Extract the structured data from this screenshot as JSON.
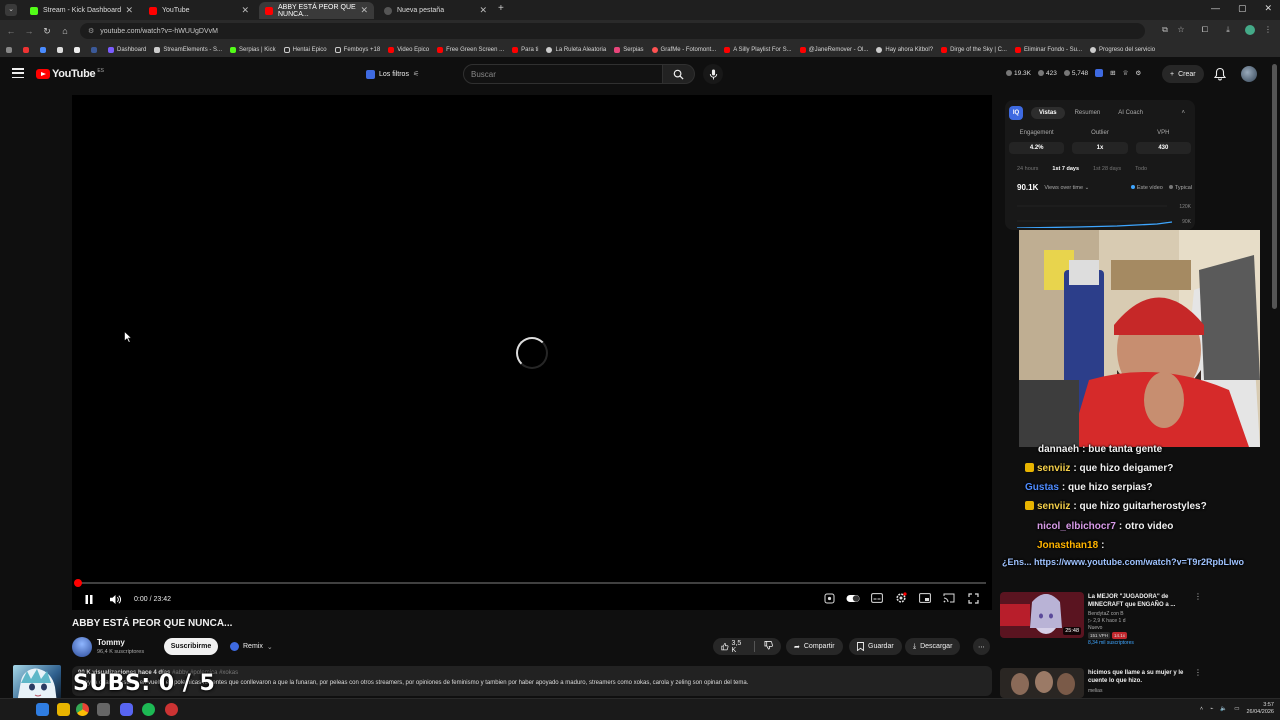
{
  "browser": {
    "tabs": [
      {
        "title": "Stream - Kick Dashboard",
        "color": "#53fc18",
        "active": false
      },
      {
        "title": "YouTube",
        "color": "#ff0000",
        "active": false
      },
      {
        "title": "ABBY ESTÁ PEOR QUE NUNCA...",
        "color": "#ff0000",
        "active": true
      },
      {
        "title": "Nueva pestaña",
        "color": "#cccccc",
        "active": false
      }
    ],
    "new_tab": "+",
    "url": "youtube.com/watch?v=-hWUUgDVvM",
    "bookmarks": [
      {
        "label": "Dashboard",
        "color": "#7b5cff"
      },
      {
        "label": "StreamElements - S...",
        "color": "#cccccc"
      },
      {
        "label": "Serpias | Kick",
        "color": "#53fc18"
      },
      {
        "label": "Hentai Epico",
        "color": "#cccccc"
      },
      {
        "label": "Femboys +18",
        "color": "#cccccc"
      },
      {
        "label": "Video Epico",
        "color": "#ff0000"
      },
      {
        "label": "Free Green Screen ...",
        "color": "#ff0000"
      },
      {
        "label": "Para ti",
        "color": "#ff0000"
      },
      {
        "label": "La Ruleta Aleatoria",
        "color": "#cccccc"
      },
      {
        "label": "Serpias",
        "color": "#e8457a"
      },
      {
        "label": "GrafMe - Fotomont...",
        "color": "#ff5252"
      },
      {
        "label": "A Silly Playlist For S...",
        "color": "#ff0000"
      },
      {
        "label": "@JaneRemover - Ol...",
        "color": "#ff0000"
      },
      {
        "label": "Hay ahora Kitbol?",
        "color": "#cccccc"
      },
      {
        "label": "Dirge of the Sky | C...",
        "color": "#ff0000"
      },
      {
        "label": "Eliminar Fondo - Su...",
        "color": "#ff0000"
      },
      {
        "label": "Progreso del servicio",
        "color": "#cccccc"
      }
    ]
  },
  "masthead": {
    "logo_text": "YouTube",
    "logo_country": "ES",
    "filters_label": "Los filtros",
    "search_placeholder": "Buscar",
    "stats": [
      "19.3K",
      "423",
      "5,748"
    ],
    "create_label": "Crear"
  },
  "player": {
    "state": "loading",
    "progress": 0.0,
    "time_current": "0:00",
    "time_total": "23:42",
    "time_display": "0:00 / 23:42"
  },
  "video": {
    "title": "ABBY ESTÁ PEOR QUE NUNCA...",
    "channel_name": "Tommy",
    "channel_subs": "96,4 K suscriptores",
    "subscribe_label": "Suscribirme",
    "remix_label": "Remix",
    "likes": "3,5 K",
    "share_label": "Compartir",
    "save_label": "Guardar",
    "download_label": "Descargar",
    "desc_meta": "90 K visualizaciones  hace 4 días",
    "desc_tags": "#abby #polemica #xokas",
    "desc_text": "abby la cual ha estado en vuelta en polemicas resientes que conllevaron a que la funaran, por peleas con otros streamers, por opiniones de feminismo y tambien por haber apoyado a maduro, streamers como xokas, carola y zeling son opinan del tema."
  },
  "overlay": {
    "subs_counter": "SUBS: 0 / 5"
  },
  "side_panel": {
    "logo": "IQ",
    "tabs": [
      "Vistas",
      "Resumen",
      "AI Coach"
    ],
    "active_tab": "Vistas",
    "metrics": [
      {
        "label": "Engagement",
        "value": "4.2%"
      },
      {
        "label": "Outlier",
        "value": "1x"
      },
      {
        "label": "VPH",
        "value": "430"
      }
    ],
    "ranges": [
      "24 hours",
      "1st 7 days",
      "1st 28 days",
      "Todo"
    ],
    "active_range": "1st 7 days",
    "views_total": "90.1K",
    "views_dropdown": "Views over time",
    "legend_this": "Este vídeo",
    "legend_typical": "Typical",
    "chart_ticks": [
      "120K",
      "90K"
    ]
  },
  "chat": [
    {
      "user": "dannaeh",
      "message": "bue tanta gente",
      "color": "#ffffff",
      "badge": false
    },
    {
      "user": "senviiz",
      "message": "que hizo deigamer?",
      "color": "#ffffff",
      "badge": true
    },
    {
      "user": "Gustas",
      "message": "que hizo serpias?",
      "color": "#4f8cff",
      "badge": false
    },
    {
      "user": "senviiz",
      "message": "que hizo guitarherostyles?",
      "color": "#ffffff",
      "badge": true
    },
    {
      "user": "nicol_elbichocr7",
      "message": "otro video",
      "color": "#ffffff",
      "badge": false
    },
    {
      "user": "Jonasthan18",
      "message": "",
      "color": "#ffb400",
      "badge": false
    },
    {
      "user": "",
      "message": "¿Ens... https://www.youtube.com/watch?v=T9r2RpbLlwo",
      "color": "#ffffff",
      "badge": false
    }
  ],
  "recommendations": [
    {
      "title": "La MEJOR \"JUGADORA\" de MINECRAFT que ENGAÑO a ...",
      "channel": "BendytaZ con B",
      "meta": "2,9 K  hace 1 d",
      "badge_new": "Nuevo",
      "vph": "151 VPH",
      "score": "14.1x",
      "subs": "8,34 mil suscriptores",
      "duration": "25:48"
    },
    {
      "title": "hicimos que llame a su mujer y le cuente lo que hizo.",
      "channel": "melias",
      "meta": "",
      "badge_new": "",
      "vph": "",
      "score": "",
      "subs": "",
      "duration": ""
    }
  ],
  "taskbar": {
    "time": "3:57",
    "date": "26/04/2026"
  }
}
